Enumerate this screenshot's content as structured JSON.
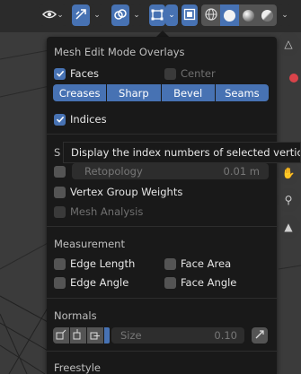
{
  "panel": {
    "title": "Mesh Edit Mode Overlays",
    "faces_label": "Faces",
    "center_label": "Center",
    "segments": [
      "Creases",
      "Sharp",
      "Bevel",
      "Seams"
    ],
    "indices_label": "Indices",
    "s_partial": "S",
    "retopology_label": "Retopology",
    "retopology_value": "0.01 m",
    "vertex_group_weights_label": "Vertex Group Weights",
    "mesh_analysis_label": "Mesh Analysis",
    "measurement_title": "Measurement",
    "edge_length_label": "Edge Length",
    "face_area_label": "Face Area",
    "edge_angle_label": "Edge Angle",
    "face_angle_label": "Face Angle",
    "normals_title": "Normals",
    "size_label": "Size",
    "size_value": "0.10",
    "freestyle_title": "Freestyle"
  },
  "tooltip": {
    "text": "Display the index numbers of selected vertices, e"
  },
  "colors": {
    "accent": "#4772b3",
    "panel_bg": "#191919",
    "header_bg": "#2b2b2b"
  },
  "icons": [
    "visibility-eye-icon",
    "gizmo-icon",
    "overlay-icon",
    "mesh-select-overlay-icon",
    "xray-icon",
    "wireframe-shading-icon",
    "solid-shading-icon",
    "material-shading-icon",
    "rendered-shading-icon",
    "hand-pan-icon",
    "camera-icon"
  ]
}
